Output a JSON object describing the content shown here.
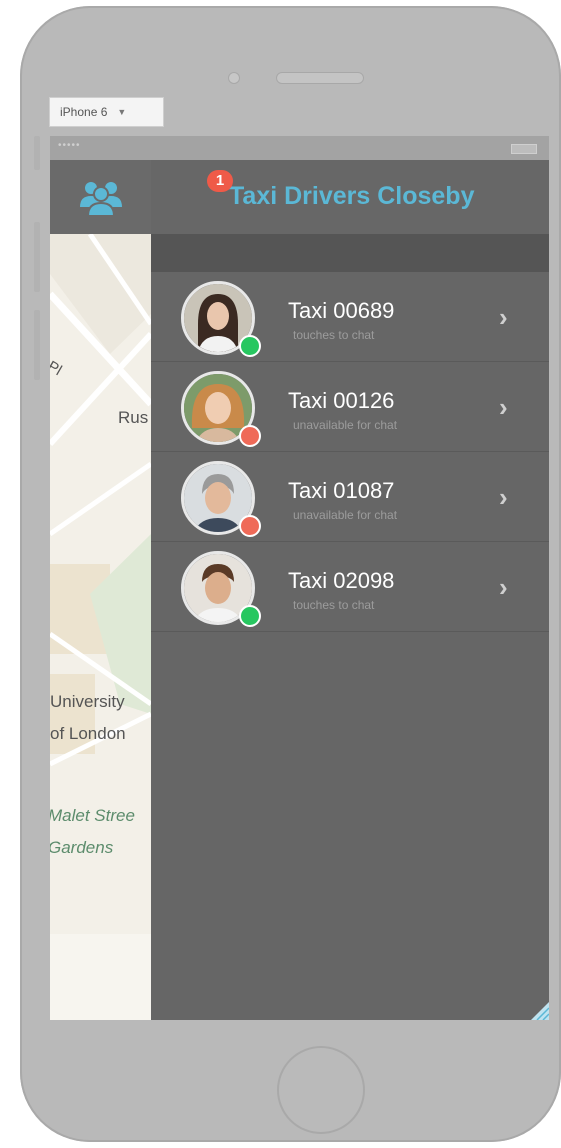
{
  "device_selector": {
    "label": "iPhone 6",
    "arrow_icon": "chevron-down-icon"
  },
  "status_bar": {
    "dots": "•••••",
    "battery_icon": "battery-icon"
  },
  "left_panel": {
    "header_icon": "group-icon",
    "map_labels": [
      "Pl",
      "Rus",
      "University",
      "of London",
      "Malet Stree",
      "Gardens"
    ]
  },
  "header": {
    "title": "Taxi Drivers Closeby",
    "badge": "1"
  },
  "drivers": [
    {
      "name": "Taxi 00689",
      "status": "touches to chat",
      "online": true
    },
    {
      "name": "Taxi 00126",
      "status": "unavailable for chat",
      "online": false
    },
    {
      "name": "Taxi 01087",
      "status": "unavailable for chat",
      "online": false
    },
    {
      "name": "Taxi 02098",
      "status": "touches to chat",
      "online": true
    }
  ],
  "colors": {
    "accent": "#5bb8d6",
    "online": "#27c760",
    "offline": "#ef6a58",
    "badge": "#ef5a48",
    "panel": "#666666"
  },
  "row_chevron_icon": "chevron-right-icon"
}
